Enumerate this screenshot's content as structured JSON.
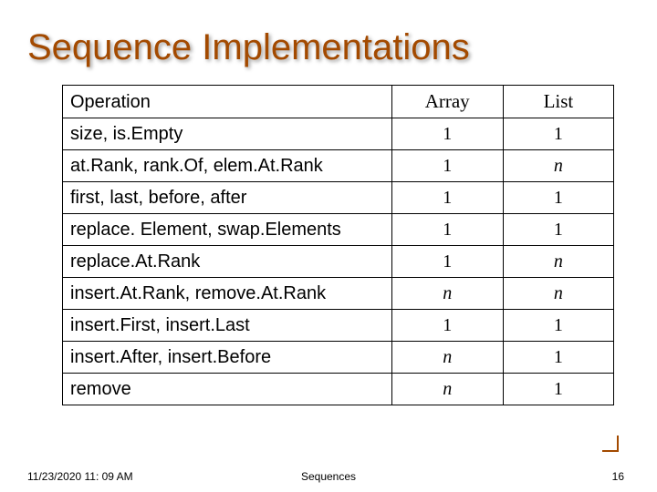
{
  "title": "Sequence Implementations",
  "chart_data": {
    "type": "table",
    "columns": [
      "Operation",
      "Array",
      "List"
    ],
    "rows": [
      {
        "op": "size, is.Empty",
        "array": "1",
        "list": "1",
        "array_italic": false,
        "list_italic": false
      },
      {
        "op": "at.Rank, rank.Of, elem.At.Rank",
        "array": "1",
        "list": "n",
        "array_italic": false,
        "list_italic": true
      },
      {
        "op": "first, last, before, after",
        "array": "1",
        "list": "1",
        "array_italic": false,
        "list_italic": false
      },
      {
        "op": "replace. Element, swap.Elements",
        "array": "1",
        "list": "1",
        "array_italic": false,
        "list_italic": false
      },
      {
        "op": "replace.At.Rank",
        "array": "1",
        "list": "n",
        "array_italic": false,
        "list_italic": true
      },
      {
        "op": "insert.At.Rank, remove.At.Rank",
        "array": "n",
        "list": "n",
        "array_italic": true,
        "list_italic": true
      },
      {
        "op": "insert.First, insert.Last",
        "array": "1",
        "list": "1",
        "array_italic": false,
        "list_italic": false
      },
      {
        "op": "insert.After, insert.Before",
        "array": "n",
        "list": "1",
        "array_italic": true,
        "list_italic": false
      },
      {
        "op": "remove",
        "array": "n",
        "list": "1",
        "array_italic": true,
        "list_italic": false
      }
    ]
  },
  "footer": {
    "timestamp": "11/23/2020 11: 09 AM",
    "center": "Sequences",
    "page": "16"
  }
}
